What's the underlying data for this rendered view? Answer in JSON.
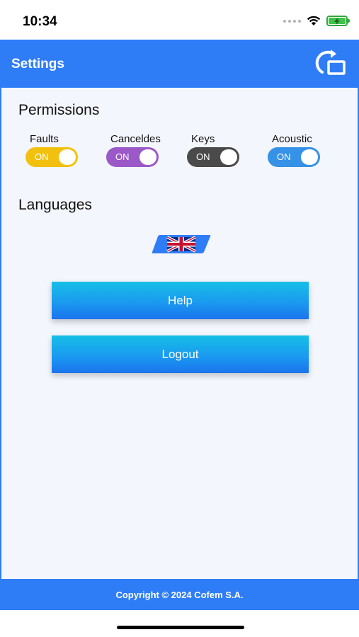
{
  "status_bar": {
    "time": "10:34",
    "icons": [
      "cellular-dots-icon",
      "wifi-icon",
      "battery-charging-icon"
    ],
    "battery_color": "#3ec24a"
  },
  "header": {
    "title": "Settings",
    "icon": "rotate-screen-icon",
    "background": "#2f7df6"
  },
  "permissions": {
    "title": "Permissions",
    "items": [
      {
        "label": "Faults",
        "state": "ON",
        "color": "#f2c10f"
      },
      {
        "label": "Canceldes",
        "state": "ON",
        "color": "#9b59c8"
      },
      {
        "label": "Keys",
        "state": "ON",
        "color": "#4a4a4a"
      },
      {
        "label": "Acoustic",
        "state": "ON",
        "color": "#3592e6"
      }
    ]
  },
  "languages": {
    "title": "Languages",
    "selected_icon": "uk-flag-icon"
  },
  "buttons": {
    "help": "Help",
    "logout": "Logout"
  },
  "footer": {
    "text": "Copyright © 2024 Cofem S.A."
  }
}
